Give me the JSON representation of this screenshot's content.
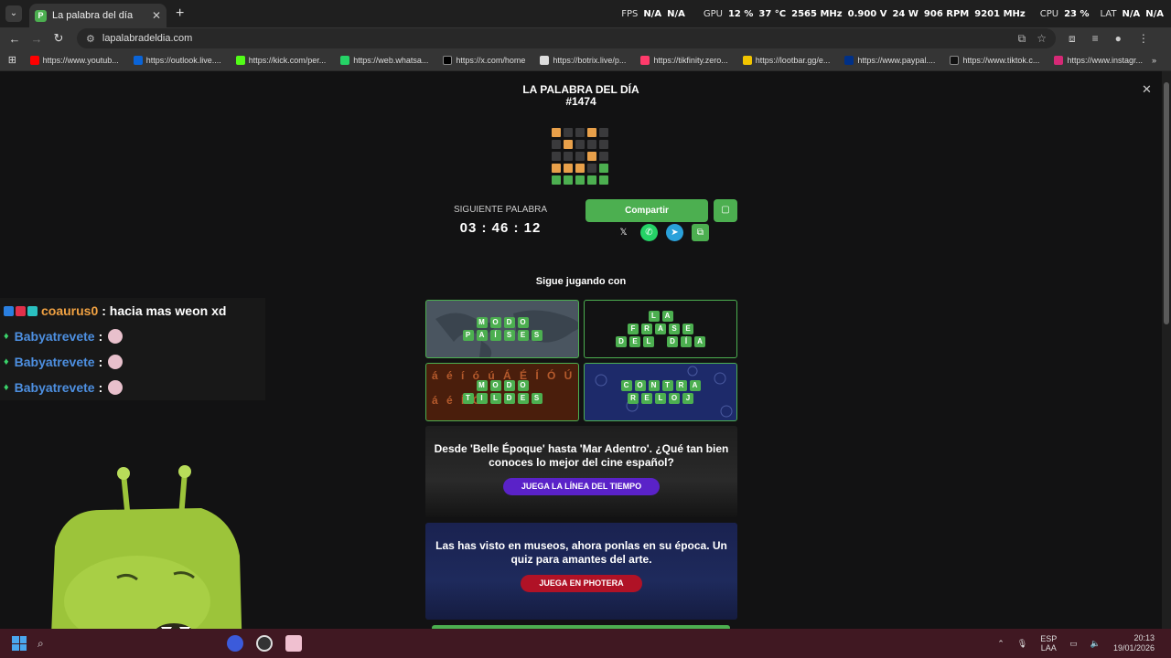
{
  "browser": {
    "tab_title": "La palabra del día",
    "tab_favicon": "P",
    "url": "lapalabradeldia.com",
    "hud": {
      "fps_label": "FPS",
      "fps_value": "N/A",
      "fps_value2": "N/A",
      "gpu_label": "GPU",
      "gpu_load": "12 %",
      "gpu_temp": "37 °C",
      "gpu_clock": "2565 MHz",
      "gpu_volt": "0.900 V",
      "gpu_power": "24 W",
      "gpu_fan": "906 RPM",
      "gpu_mem": "9201 MHz",
      "cpu_label": "CPU",
      "cpu_load": "23 %",
      "lat_label": "LAT",
      "lat_value": "N/A",
      "lat_value2": "N/A"
    },
    "bookmarks": [
      {
        "label": "https://www.youtub...",
        "color": "#ff0000"
      },
      {
        "label": "https://outlook.live....",
        "color": "#0a64d8"
      },
      {
        "label": "https://kick.com/per...",
        "color": "#53fc18"
      },
      {
        "label": "https://web.whatsa...",
        "color": "#25d366"
      },
      {
        "label": "https://x.com/home",
        "color": "#000000"
      },
      {
        "label": "https://botrix.live/p...",
        "color": "#dddddd"
      },
      {
        "label": "https://tikfinity.zero...",
        "color": "#ff3b6b"
      },
      {
        "label": "https://lootbar.gg/e...",
        "color": "#f2c500"
      },
      {
        "label": "https://www.paypal....",
        "color": "#003087"
      },
      {
        "label": "https://www.tiktok.c...",
        "color": "#111111"
      },
      {
        "label": "https://www.instagr...",
        "color": "#d62976"
      }
    ]
  },
  "page": {
    "title_line1": "LA PALABRA DEL DÍA",
    "title_line2": "#1474",
    "result_grid": [
      [
        "o",
        "g",
        "g",
        "o",
        "g"
      ],
      [
        "g",
        "o",
        "g",
        "g",
        "g"
      ],
      [
        "g",
        "g",
        "g",
        "o",
        "g"
      ],
      [
        "o",
        "o",
        "o",
        "g",
        "G"
      ],
      [
        "G",
        "G",
        "G",
        "G",
        "G"
      ]
    ],
    "colors": {
      "green": "#4caf50",
      "orange": "#e8a04a",
      "gray": "#3a3a3c"
    },
    "next_word_label": "SIGUIENTE PALABRA",
    "countdown": "03 : 46 : 12",
    "share_label": "Compartir",
    "keep_playing_label": "Sigue jugando con",
    "games": {
      "paises": {
        "row1": [
          "M",
          "O",
          "D",
          "O"
        ],
        "row2": [
          "P",
          "A",
          "Í",
          "S",
          "E",
          "S"
        ]
      },
      "frase": {
        "row1": [
          "L",
          "A"
        ],
        "row2": [
          "F",
          "R",
          "A",
          "S",
          "E"
        ],
        "row3a": [
          "D",
          "E",
          "L"
        ],
        "row3b": [
          "D",
          "Í",
          "A"
        ]
      },
      "tildes": {
        "row1": [
          "M",
          "O",
          "D",
          "O"
        ],
        "row2": [
          "T",
          "I",
          "L",
          "D",
          "E",
          "S"
        ],
        "bg1": "á é í ó ú Á É Í Ó Ú",
        "bg2": "á é Í Ó Ú"
      },
      "reloj": {
        "row1": [
          "C",
          "O",
          "N",
          "T",
          "R",
          "A"
        ],
        "row2": [
          "R",
          "E",
          "L",
          "O",
          "J"
        ]
      }
    },
    "promo1": {
      "text": "Desde 'Belle Époque' hasta 'Mar Adentro'. ¿Qué tan bien conoces lo mejor del cine español?",
      "button": "JUEGA LA LÍNEA DEL TIEMPO"
    },
    "promo2": {
      "text": "Las has visto en museos, ahora ponlas en su época. Un quiz para amantes del arte.",
      "button": "JUEGA EN PHOTERA"
    }
  },
  "chat": [
    {
      "user": "coaurus0",
      "message": ": hacia mas weon xd",
      "color": "#f0a142"
    },
    {
      "user": "Babyatrevete",
      "message": ":",
      "color": "#4d8fe0"
    },
    {
      "user": "Babyatrevete",
      "message": ":",
      "color": "#4d8fe0"
    },
    {
      "user": "Babyatrevete",
      "message": ":",
      "color": "#4d8fe0"
    }
  ],
  "taskbar": {
    "lang1": "ESP",
    "lang2": "LAA",
    "time": "20:13",
    "date": "19/01/2026"
  }
}
